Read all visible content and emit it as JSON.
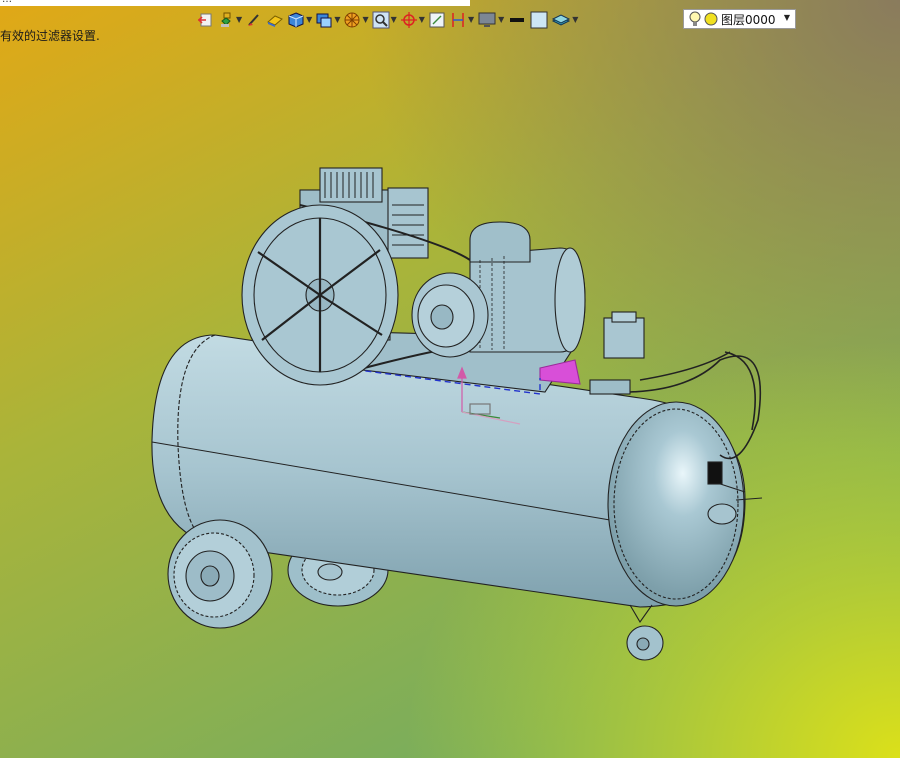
{
  "window": {
    "title_fragment": "…"
  },
  "status": {
    "message": "有效的过滤器设置."
  },
  "toolbar": {
    "items": [
      {
        "name": "exit-icon",
        "has_dropdown": false
      },
      {
        "name": "tree-icon",
        "has_dropdown": true
      },
      {
        "name": "brush-icon",
        "has_dropdown": false
      },
      {
        "name": "eraser-icon",
        "has_dropdown": false
      },
      {
        "name": "cube-icon",
        "has_dropdown": true
      },
      {
        "name": "layer-view-icon",
        "has_dropdown": true
      },
      {
        "name": "wheel-icon",
        "has_dropdown": true
      },
      {
        "name": "zoom-icon",
        "has_dropdown": true
      },
      {
        "name": "target-icon",
        "has_dropdown": true
      },
      {
        "name": "fit-icon",
        "has_dropdown": false
      },
      {
        "name": "section-icon",
        "has_dropdown": true
      },
      {
        "name": "monitor-icon",
        "has_dropdown": true
      },
      {
        "name": "line-icon",
        "has_dropdown": false
      },
      {
        "name": "fill-color-icon",
        "has_dropdown": false
      },
      {
        "name": "layers-icon",
        "has_dropdown": true
      }
    ]
  },
  "layer_selector": {
    "label": "图层0000"
  },
  "colors": {
    "bg_top_left": "#e0aa17",
    "bg_center": "#a8b53a",
    "bg_top_right": "#8e7e58",
    "bg_bottom_left": "#74ad63",
    "bg_bottom_right": "#d4dc1d",
    "model_fill": "#a6c4cf",
    "model_edge": "#222222",
    "selection": "#2233cc",
    "highlight_face": "#d84fd8"
  }
}
